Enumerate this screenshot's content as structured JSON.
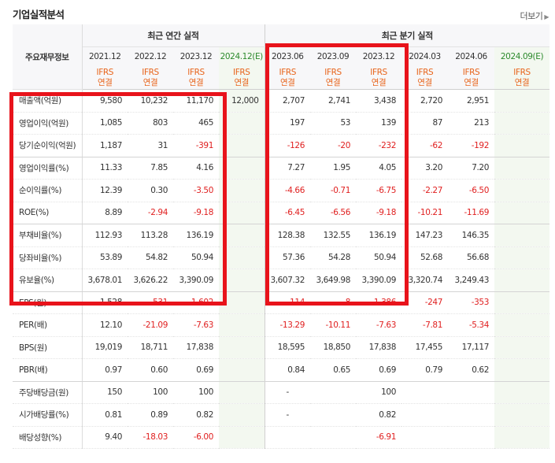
{
  "section_title": "기업실적분석",
  "more_label": "더보기",
  "more_icon": "triangle-right-icon",
  "header": {
    "label_col": "주요재무정보",
    "annual_group": "최근 연간 실적",
    "quarter_group": "최근 분기 실적",
    "annual_periods": [
      "2021.12",
      "2022.12",
      "2023.12",
      "2024.12(E)"
    ],
    "quarter_periods": [
      "2023.06",
      "2023.09",
      "2023.12",
      "2024.03",
      "2024.06",
      "2024.09(E)"
    ],
    "basis_top": "IFRS",
    "basis_bottom": "연결"
  },
  "colors": {
    "negative": "#e02020",
    "basis": "#e8641b",
    "estimate_text": "#2c8a2c",
    "highlight_box": "#e8131b"
  },
  "rows": [
    {
      "label": "매출액(억원)",
      "cells": [
        "9,580",
        "10,232",
        "11,170",
        "12,000",
        "2,707",
        "2,741",
        "3,438",
        "2,720",
        "2,951",
        ""
      ]
    },
    {
      "label": "영업이익(억원)",
      "cells": [
        "1,085",
        "803",
        "465",
        "",
        "197",
        "53",
        "139",
        "87",
        "213",
        ""
      ]
    },
    {
      "label": "당기순이익(억원)",
      "cells": [
        "1,187",
        "31",
        "-391",
        "",
        "-126",
        "-20",
        "-232",
        "-62",
        "-192",
        ""
      ]
    },
    {
      "label": "영업이익률(%)",
      "cells": [
        "11.33",
        "7.85",
        "4.16",
        "",
        "7.27",
        "1.95",
        "4.05",
        "3.20",
        "7.20",
        ""
      ]
    },
    {
      "label": "순이익률(%)",
      "cells": [
        "12.39",
        "0.30",
        "-3.50",
        "",
        "-4.66",
        "-0.71",
        "-6.75",
        "-2.27",
        "-6.50",
        ""
      ]
    },
    {
      "label": "ROE(%)",
      "cells": [
        "8.89",
        "-2.94",
        "-9.18",
        "",
        "-6.45",
        "-6.56",
        "-9.18",
        "-10.21",
        "-11.69",
        ""
      ]
    },
    {
      "label": "부채비율(%)",
      "cells": [
        "112.93",
        "113.28",
        "136.19",
        "",
        "128.38",
        "132.55",
        "136.19",
        "147.23",
        "146.35",
        ""
      ]
    },
    {
      "label": "당좌비율(%)",
      "cells": [
        "53.89",
        "54.82",
        "50.94",
        "",
        "57.36",
        "54.28",
        "50.94",
        "52.68",
        "56.68",
        ""
      ]
    },
    {
      "label": "유보율(%)",
      "cells": [
        "3,678.01",
        "3,626.22",
        "3,390.09",
        "",
        "3,607.32",
        "3,649.98",
        "3,390.09",
        "3,320.74",
        "3,249.43",
        ""
      ]
    },
    {
      "label": "EPS(원)",
      "cells": [
        "1,528",
        "-531",
        "-1,602",
        "",
        "-114",
        "-8",
        "-1,386",
        "-247",
        "-353",
        ""
      ]
    },
    {
      "label": "PER(배)",
      "cells": [
        "12.10",
        "-21.09",
        "-7.63",
        "",
        "-13.29",
        "-10.11",
        "-7.63",
        "-7.81",
        "-5.34",
        ""
      ]
    },
    {
      "label": "BPS(원)",
      "cells": [
        "19,019",
        "18,711",
        "17,838",
        "",
        "18,595",
        "18,850",
        "17,838",
        "17,455",
        "17,117",
        ""
      ]
    },
    {
      "label": "PBR(배)",
      "cells": [
        "0.97",
        "0.60",
        "0.69",
        "",
        "0.84",
        "0.65",
        "0.69",
        "0.79",
        "0.62",
        ""
      ]
    },
    {
      "label": "주당배당금(원)",
      "cells": [
        "150",
        "100",
        "100",
        "",
        "-",
        "",
        "100",
        "",
        "",
        ""
      ]
    },
    {
      "label": "시가배당률(%)",
      "cells": [
        "0.81",
        "0.89",
        "0.82",
        "",
        "-",
        "",
        "0.82",
        "",
        "",
        ""
      ]
    },
    {
      "label": "배당성향(%)",
      "cells": [
        "9.40",
        "-18.03",
        "-6.00",
        "",
        "",
        "",
        "-6.91",
        "",
        "",
        ""
      ]
    }
  ]
}
